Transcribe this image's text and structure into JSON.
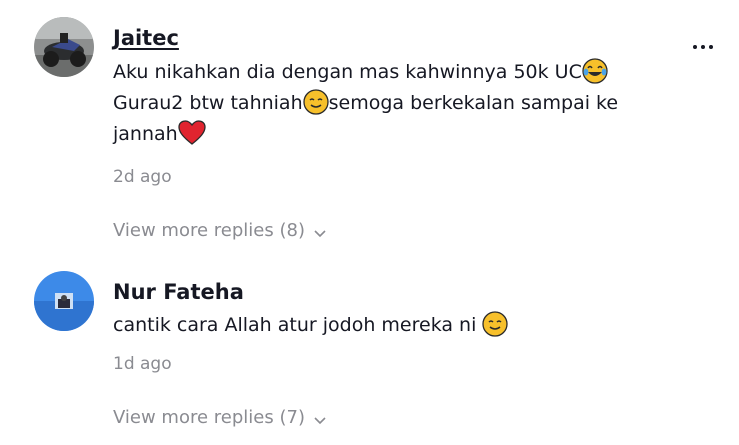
{
  "comments": [
    {
      "username": "Jaitec",
      "text_line1": "Aku nikahkan dia dengan mas kahwinnya 50k UC",
      "text_line2a": "Gurau2 btw tahniah",
      "text_line2b": "semoga berkekalan sampai ke",
      "text_line3": "jannah",
      "timestamp": "2d ago",
      "view_more": "View more replies (8)"
    },
    {
      "username": "Nur Fateha",
      "text": "cantik cara Allah atur jodoh mereka ni",
      "timestamp": "1d ago",
      "view_more": "View more replies (7)"
    }
  ],
  "icons": {
    "more_options": "more-options-icon",
    "chevron": "chevron-down-icon",
    "emoji_laugh": "tears-of-joy-emoji",
    "emoji_smile": "smiling-face-emoji",
    "emoji_heart": "red-heart-emoji"
  },
  "colors": {
    "text": "#161823",
    "muted": "#8a8b91",
    "emoji_yellow": "#f7c02b",
    "heart_red": "#e0242f"
  }
}
